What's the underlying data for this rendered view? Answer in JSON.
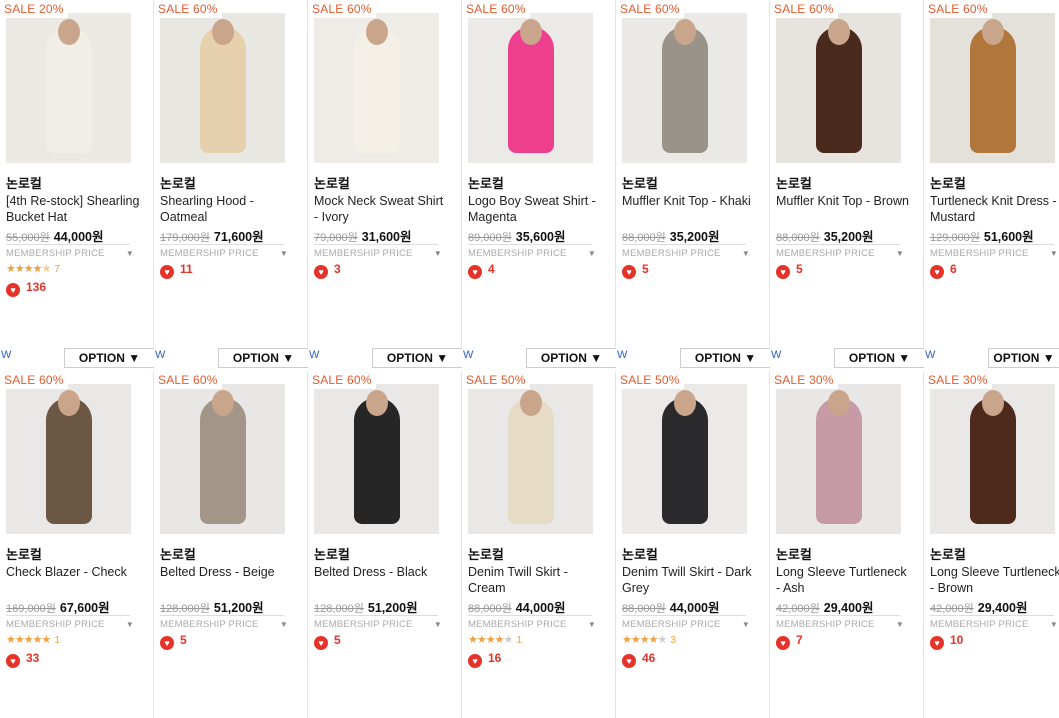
{
  "products": [
    {
      "sale": "SALE 20%",
      "brand": "논로컬",
      "name": "[4th Re-stock] Shearling Bucket Hat",
      "orig": "55,000원",
      "price": "44,000원",
      "member": "MEMBERSHIP PRICE",
      "stars": "★★★★",
      "half": "★",
      "empty": "",
      "review_count": "7",
      "rating": 4.5,
      "likes": "136",
      "colors": {
        "bg": "#ece9e4",
        "fig": "#f1eee8"
      }
    },
    {
      "sale": "SALE 60%",
      "brand": "논로컬",
      "name": "Shearling Hood - Oatmeal",
      "orig": "179,000원",
      "price": "71,600원",
      "member": "MEMBERSHIP PRICE",
      "likes": "11",
      "colors": {
        "bg": "#e9e7e2",
        "fig": "#e6d0ad"
      }
    },
    {
      "sale": "SALE 60%",
      "brand": "논로컬",
      "name": "Mock Neck Sweat Shirt - Ivory",
      "orig": "79,000원",
      "price": "31,600원",
      "member": "MEMBERSHIP PRICE",
      "likes": "3",
      "colors": {
        "bg": "#efece7",
        "fig": "#f4f0e8"
      }
    },
    {
      "sale": "SALE 60%",
      "brand": "논로컬",
      "name": "Logo Boy Sweat Shirt - Magenta",
      "orig": "89,000원",
      "price": "35,600원",
      "member": "MEMBERSHIP PRICE",
      "likes": "4",
      "colors": {
        "bg": "#eceae6",
        "fig": "#ee3e8e"
      }
    },
    {
      "sale": "SALE 60%",
      "brand": "논로컬",
      "name": "Muffler Knit Top - Khaki",
      "orig": "88,000원",
      "price": "35,200원",
      "member": "MEMBERSHIP PRICE",
      "likes": "5",
      "colors": {
        "bg": "#ebe9e6",
        "fig": "#9a938a"
      }
    },
    {
      "sale": "SALE 60%",
      "brand": "논로컬",
      "name": "Muffler Knit Top - Brown",
      "orig": "88,000원",
      "price": "35,200원",
      "member": "MEMBERSHIP PRICE",
      "likes": "5",
      "colors": {
        "bg": "#e7e4e0",
        "fig": "#4a2a1c"
      }
    },
    {
      "sale": "SALE 60%",
      "brand": "논로컬",
      "name": "Turtleneck Knit Dress - Mustard",
      "orig": "129,000원",
      "price": "51,600원",
      "member": "MEMBERSHIP PRICE",
      "likes": "6",
      "colors": {
        "bg": "#e4e0da",
        "fig": "#b1773a"
      }
    },
    {
      "sale": "SALE 60%",
      "brand": "논로컬",
      "name": "Check Blazer - Check",
      "orig": "169,000원",
      "price": "67,600원",
      "member": "MEMBERSHIP PRICE",
      "stars": "★★★★★",
      "half": "",
      "empty": "",
      "review_count": "1",
      "rating": 5,
      "likes": "33",
      "colors": {
        "bg": "#e9e8e6",
        "fig": "#6c5644"
      }
    },
    {
      "sale": "SALE 60%",
      "brand": "논로컬",
      "name": "Belted Dress - Beige",
      "orig": "128,000원",
      "price": "51,200원",
      "member": "MEMBERSHIP PRICE",
      "likes": "5",
      "colors": {
        "bg": "#e8e7e5",
        "fig": "#a39587"
      }
    },
    {
      "sale": "SALE 60%",
      "brand": "논로컬",
      "name": "Belted Dress - Black",
      "orig": "128,000원",
      "price": "51,200원",
      "member": "MEMBERSHIP PRICE",
      "likes": "5",
      "colors": {
        "bg": "#e9e8e6",
        "fig": "#262626"
      }
    },
    {
      "sale": "SALE 50%",
      "brand": "논로컬",
      "name": "Denim Twill Skirt - Cream",
      "orig": "88,000원",
      "price": "44,000원",
      "member": "MEMBERSHIP PRICE",
      "stars": "★★★★",
      "half": "",
      "empty": "★",
      "review_count": "1",
      "rating": 4,
      "likes": "16",
      "colors": {
        "bg": "#e9e8e6",
        "fig": "#e6dcc5"
      }
    },
    {
      "sale": "SALE 50%",
      "brand": "논로컬",
      "name": "Denim Twill Skirt - Dark Grey",
      "orig": "88,000원",
      "price": "44,000원",
      "member": "MEMBERSHIP PRICE",
      "stars": "★★★★",
      "half": "",
      "empty": "★",
      "review_count": "3",
      "rating": 4,
      "likes": "46",
      "colors": {
        "bg": "#ebeae8",
        "fig": "#2a2a2c"
      }
    },
    {
      "sale": "SALE 30%",
      "brand": "논로컬",
      "name": "Long Sleeve Turtleneck - Ash",
      "orig": "42,000원",
      "price": "29,400원",
      "member": "MEMBERSHIP PRICE",
      "likes": "7",
      "colors": {
        "bg": "#e8e7e5",
        "fig": "#c79aa8"
      }
    },
    {
      "sale": "SALE 30%",
      "brand": "논로컬",
      "name": "Long Sleeve Turtleneck - Brown",
      "orig": "42,000원",
      "price": "29,400원",
      "member": "MEMBERSHIP PRICE",
      "likes": "10",
      "colors": {
        "bg": "#e9e8e6",
        "fig": "#4e2a1d"
      }
    }
  ],
  "option_label": "OPTION ▼",
  "wish_label": "W"
}
